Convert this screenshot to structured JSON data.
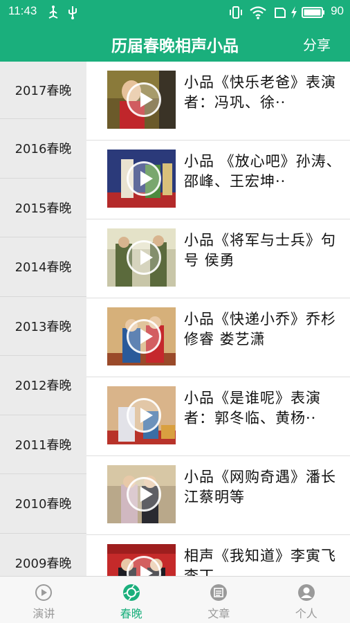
{
  "status_bar": {
    "time": "11:43",
    "battery_level": "90",
    "icons": [
      "usb-icon",
      "usb-debug-icon",
      "vibrate-icon",
      "wifi-icon",
      "sim-icon",
      "charging-icon",
      "battery-icon"
    ]
  },
  "app_bar": {
    "title": "历届春晚相声小品",
    "share_label": "分享"
  },
  "years": [
    "2017春晚",
    "2016春晚",
    "2015春晚",
    "2014春晚",
    "2013春晚",
    "2012春晚",
    "2011春晚",
    "2010春晚",
    "2009春晚"
  ],
  "selected_year": "2017春晚",
  "videos": [
    {
      "title": "小品《快乐老爸》表演者：冯巩、徐··",
      "icon": "play-icon"
    },
    {
      "title": "小品 《放心吧》孙涛、邵峰、王宏坤··",
      "icon": "play-icon"
    },
    {
      "title": "小品《将军与士兵》句号 侯勇",
      "icon": "play-icon"
    },
    {
      "title": "小品《快递小乔》乔杉 修睿 娄艺潇",
      "icon": "play-icon"
    },
    {
      "title": "小品《是谁呢》表演者：郭冬临、黄杨··",
      "icon": "play-icon"
    },
    {
      "title": "小品《网购奇遇》潘长江蔡明等",
      "icon": "play-icon"
    },
    {
      "title": "相声《我知道》李寅飞 李丁",
      "icon": "play-icon"
    }
  ],
  "bottom_nav": [
    {
      "label": "演讲",
      "icon": "play-circle-icon",
      "active": false
    },
    {
      "label": "春晚",
      "icon": "camera-shutter-icon",
      "active": true
    },
    {
      "label": "文章",
      "icon": "article-icon",
      "active": false
    },
    {
      "label": "个人",
      "icon": "person-icon",
      "active": false
    }
  ],
  "colors": {
    "primary": "#1aaf7c",
    "sidebar_bg": "#ebebeb",
    "nav_inactive": "#9a9a9a"
  }
}
